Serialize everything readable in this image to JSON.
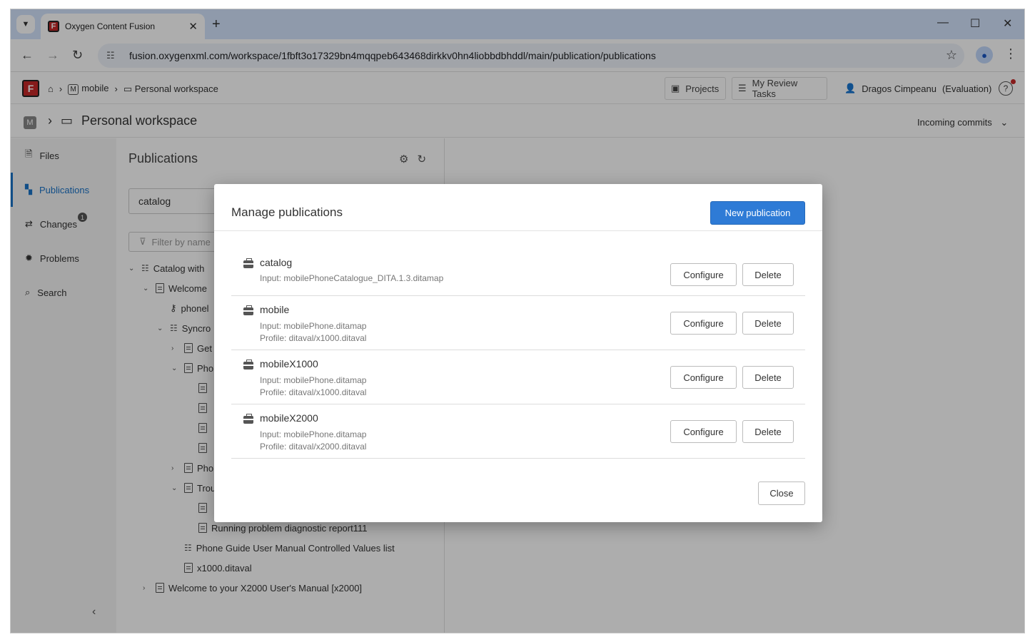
{
  "browser": {
    "tab_title": "Oxygen Content Fusion",
    "url": "fusion.oxygenxml.com/workspace/1fbft3o17329bn4mqqpeb643468dirkkv0hn4liobbdbhddl/main/publication/publications"
  },
  "appbar": {
    "crumb_project": "mobile",
    "crumb_workspace": "Personal workspace",
    "projects_label": "Projects",
    "review_label": "My Review Tasks",
    "user_name": "Dragos Cimpeanu",
    "user_role": "(Evaluation)"
  },
  "workspace": {
    "title": "Personal workspace",
    "incoming": "Incoming commits"
  },
  "sidebar": {
    "items": [
      {
        "label": "Files"
      },
      {
        "label": "Publications"
      },
      {
        "label": "Changes",
        "badge": "1"
      },
      {
        "label": "Problems"
      },
      {
        "label": "Search"
      }
    ]
  },
  "publications_panel": {
    "heading": "Publications",
    "selected": "catalog",
    "filter_placeholder": "Filter by name",
    "tree": [
      {
        "label": "Catalog with"
      },
      {
        "label": "Welcome"
      },
      {
        "label": "phonel"
      },
      {
        "label": "Syncro"
      },
      {
        "label": "Get"
      },
      {
        "label": "Pho"
      },
      {
        "label": "Pho"
      },
      {
        "label": "Trou"
      },
      {
        "label": "Running problem diagnostic report111"
      },
      {
        "label": "Phone Guide User Manual Controlled Values list"
      },
      {
        "label": "x1000.ditaval"
      },
      {
        "label": "Welcome to your X2000 User's Manual [x2000]"
      }
    ]
  },
  "dialog": {
    "title": "Manage publications",
    "new_label": "New publication",
    "configure_label": "Configure",
    "delete_label": "Delete",
    "close_label": "Close",
    "publications": [
      {
        "name": "catalog",
        "input": "Input: mobilePhoneCatalogue_DITA.1.3.ditamap",
        "profile": ""
      },
      {
        "name": "mobile",
        "input": "Input: mobilePhone.ditamap",
        "profile": "Profile: ditaval/x1000.ditaval"
      },
      {
        "name": "mobileX1000",
        "input": "Input: mobilePhone.ditamap",
        "profile": "Profile: ditaval/x1000.ditaval"
      },
      {
        "name": "mobileX2000",
        "input": "Input: mobilePhone.ditamap",
        "profile": "Profile: ditaval/x2000.ditaval"
      }
    ]
  },
  "colors": {
    "accent": "#2e7bd6",
    "brand": "#c62828"
  }
}
